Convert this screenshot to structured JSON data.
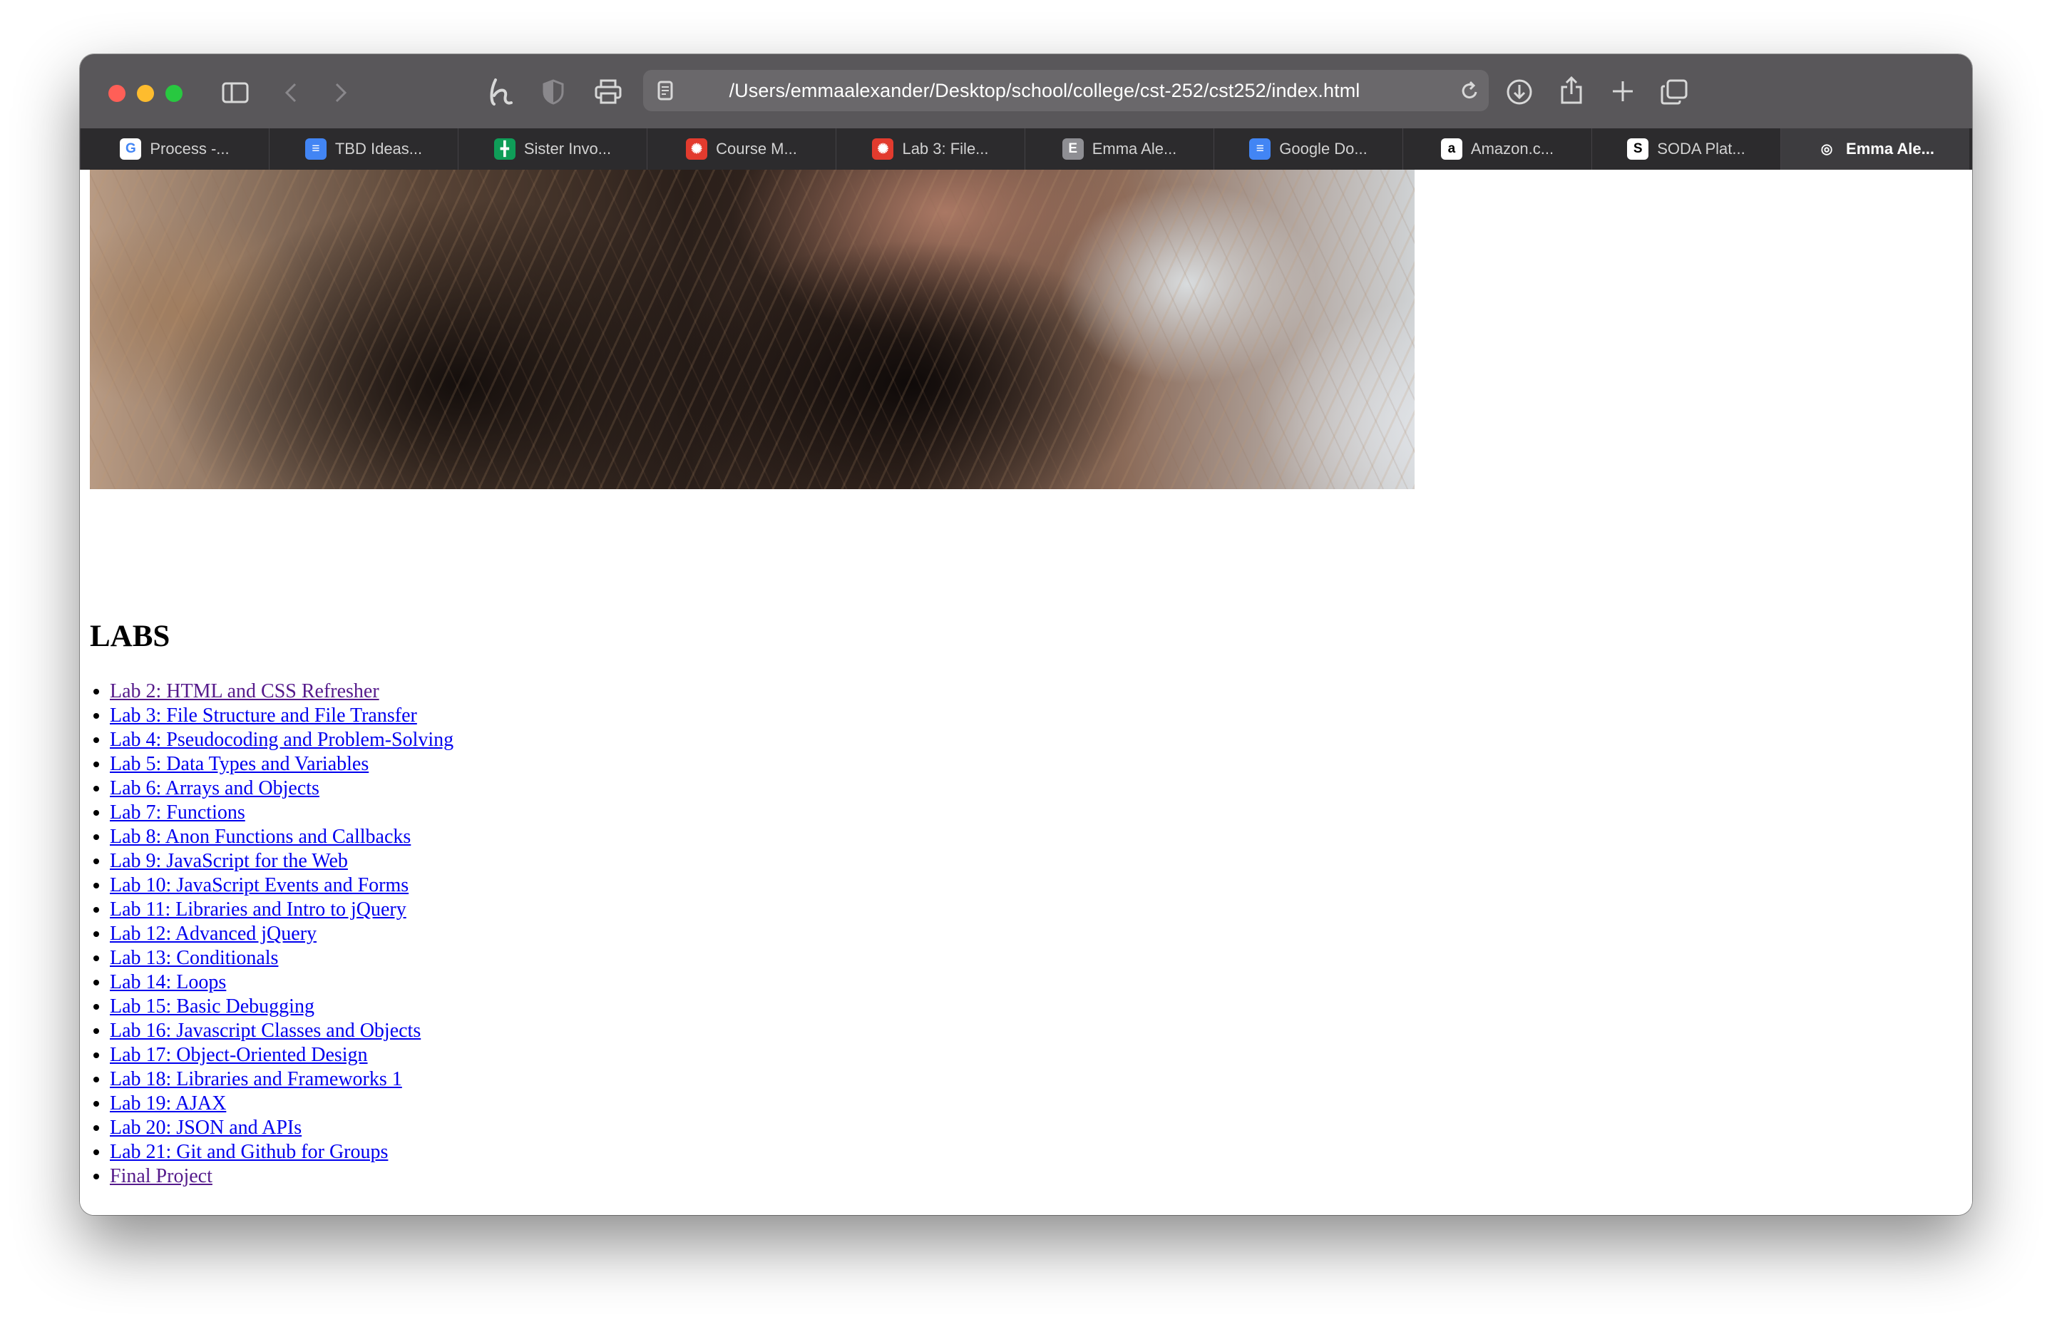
{
  "browser": {
    "address": "/Users/emmaalexander/Desktop/school/college/cst-252/cst252/index.html",
    "tabs": [
      {
        "label": "Process -...",
        "favicon": "google-icon",
        "color": "#ffffff",
        "glyph": "G",
        "glyph_color": "#4285f4"
      },
      {
        "label": "TBD Ideas...",
        "favicon": "google-docs-icon",
        "color": "#4285f4",
        "glyph": "≡",
        "glyph_color": "#ffffff"
      },
      {
        "label": "Sister Invo...",
        "favicon": "google-sheets-icon",
        "color": "#0f9d58",
        "glyph": "╋",
        "glyph_color": "#ffffff"
      },
      {
        "label": "Course M...",
        "favicon": "canvas-icon",
        "color": "#e23b2e",
        "glyph": "✺",
        "glyph_color": "#ffffff"
      },
      {
        "label": "Lab 3: File...",
        "favicon": "canvas-icon",
        "color": "#e23b2e",
        "glyph": "✺",
        "glyph_color": "#ffffff"
      },
      {
        "label": "Emma Ale...",
        "favicon": "letter-e-icon",
        "color": "#8e8e93",
        "glyph": "E",
        "glyph_color": "#ffffff"
      },
      {
        "label": "Google Do...",
        "favicon": "google-docs-icon",
        "color": "#4285f4",
        "glyph": "≡",
        "glyph_color": "#ffffff"
      },
      {
        "label": "Amazon.c...",
        "favicon": "amazon-icon",
        "color": "#ffffff",
        "glyph": "a",
        "glyph_color": "#000000"
      },
      {
        "label": "SODA Plat...",
        "favicon": "soda-icon",
        "color": "#ffffff",
        "glyph": "S",
        "glyph_color": "#000000"
      },
      {
        "label": "Emma Ale...",
        "favicon": "compass-icon",
        "color": "#3d3c3f",
        "glyph": "◎",
        "glyph_color": "#ffffff"
      }
    ]
  },
  "page": {
    "heading": "LABS",
    "labs": [
      {
        "label": "Lab 2: HTML and CSS Refresher",
        "visited": true
      },
      {
        "label": "Lab 3: File Structure and File Transfer",
        "visited": false
      },
      {
        "label": "Lab 4: Pseudocoding and Problem-Solving",
        "visited": false
      },
      {
        "label": "Lab 5: Data Types and Variables",
        "visited": false
      },
      {
        "label": "Lab 6: Arrays and Objects",
        "visited": false
      },
      {
        "label": "Lab 7: Functions",
        "visited": false
      },
      {
        "label": "Lab 8: Anon Functions and Callbacks",
        "visited": false
      },
      {
        "label": "Lab 9: JavaScript for the Web",
        "visited": false
      },
      {
        "label": "Lab 10: JavaScript Events and Forms",
        "visited": false
      },
      {
        "label": "Lab 11: Libraries and Intro to jQuery",
        "visited": false
      },
      {
        "label": "Lab 12: Advanced jQuery",
        "visited": false
      },
      {
        "label": "Lab 13: Conditionals",
        "visited": false
      },
      {
        "label": "Lab 14: Loops",
        "visited": false
      },
      {
        "label": "Lab 15: Basic Debugging",
        "visited": false
      },
      {
        "label": "Lab 16: Javascript Classes and Objects",
        "visited": false
      },
      {
        "label": "Lab 17: Object-Oriented Design",
        "visited": false
      },
      {
        "label": "Lab 18: Libraries and Frameworks 1",
        "visited": false
      },
      {
        "label": "Lab 19: AJAX",
        "visited": false
      },
      {
        "label": "Lab 20: JSON and APIs",
        "visited": false
      },
      {
        "label": "Lab 21: Git and Github for Groups",
        "visited": false
      },
      {
        "label": "Final Project",
        "visited": true
      }
    ]
  },
  "colors": {
    "link": "#0000ee",
    "visited_link": "#551a8b",
    "toolbar": "#59575a",
    "tabbar": "#2c2b2d"
  }
}
